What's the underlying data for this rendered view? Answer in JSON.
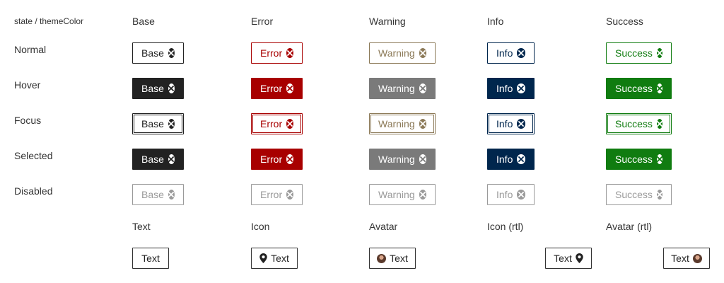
{
  "corner_label": "state / themeColor",
  "columns": [
    {
      "label": "Base"
    },
    {
      "label": "Error"
    },
    {
      "label": "Warning"
    },
    {
      "label": "Info"
    },
    {
      "label": "Success"
    }
  ],
  "states": [
    {
      "label": "Normal"
    },
    {
      "label": "Hover"
    },
    {
      "label": "Focus"
    },
    {
      "label": "Selected"
    },
    {
      "label": "Disabled"
    }
  ],
  "chips": {
    "base": "Base",
    "error": "Error",
    "warning": "Warning",
    "info": "Info",
    "success": "Success"
  },
  "theme_colors": {
    "base": "#222222",
    "error": "#a80000",
    "warning": "#8c7a58",
    "info": "#00264d",
    "success": "#107c10",
    "warning_filled": "#7a7a7a",
    "disabled": "#9a9a9a"
  },
  "examples": {
    "headers": [
      "Text",
      "Icon",
      "Avatar",
      "Icon (rtl)",
      "Avatar (rtl)"
    ],
    "chip_label": "Text",
    "icon_name": "map-pin-icon",
    "avatar_name": "user-avatar"
  }
}
